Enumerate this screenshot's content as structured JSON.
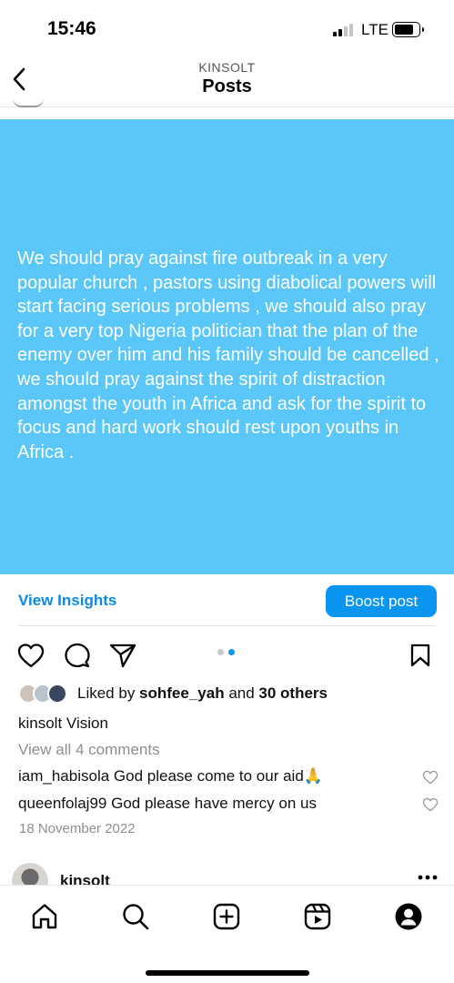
{
  "status_bar": {
    "time": "15:46",
    "network": "LTE"
  },
  "header": {
    "account": "KINSOLT",
    "title": "Posts"
  },
  "post": {
    "background_color": "#5ac7f8",
    "text": "We should pray against fire outbreak in a very popular church , pastors using diabolical powers will start facing serious problems , we should also pray for a very top Nigeria politician that the plan of the enemy over him and his family should be cancelled ,  we should pray against the spirit of distraction amongst the youth in Africa and ask for the spirit to focus and hard work should rest upon youths in Africa .",
    "view_insights": "View Insights",
    "boost_label": "Boost post",
    "carousel": {
      "count": 2,
      "active": 2
    }
  },
  "likes": {
    "prefix": "Liked by ",
    "user": "sohfee_yah",
    "middle": " and ",
    "others": "30 others"
  },
  "caption": {
    "user": "kinsolt",
    "text": "Vision"
  },
  "view_comments": "View all 4 comments",
  "comments": [
    {
      "user": "iam_habisola",
      "text": "God please come to our aid🙏"
    },
    {
      "user": "queenfolaj99",
      "text": "God please have mercy on us"
    }
  ],
  "date": "18 November 2022",
  "next_post": {
    "user": "kinsolt"
  },
  "icons": {
    "back": "chevron-left-icon",
    "like": "heart-icon",
    "comment": "comment-icon",
    "share": "send-icon",
    "save": "bookmark-icon",
    "nav": [
      "home-icon",
      "search-icon",
      "create-icon",
      "reels-icon",
      "profile-icon"
    ]
  },
  "colors": {
    "accent": "#0a95f0",
    "link": "#0b8ae8"
  }
}
